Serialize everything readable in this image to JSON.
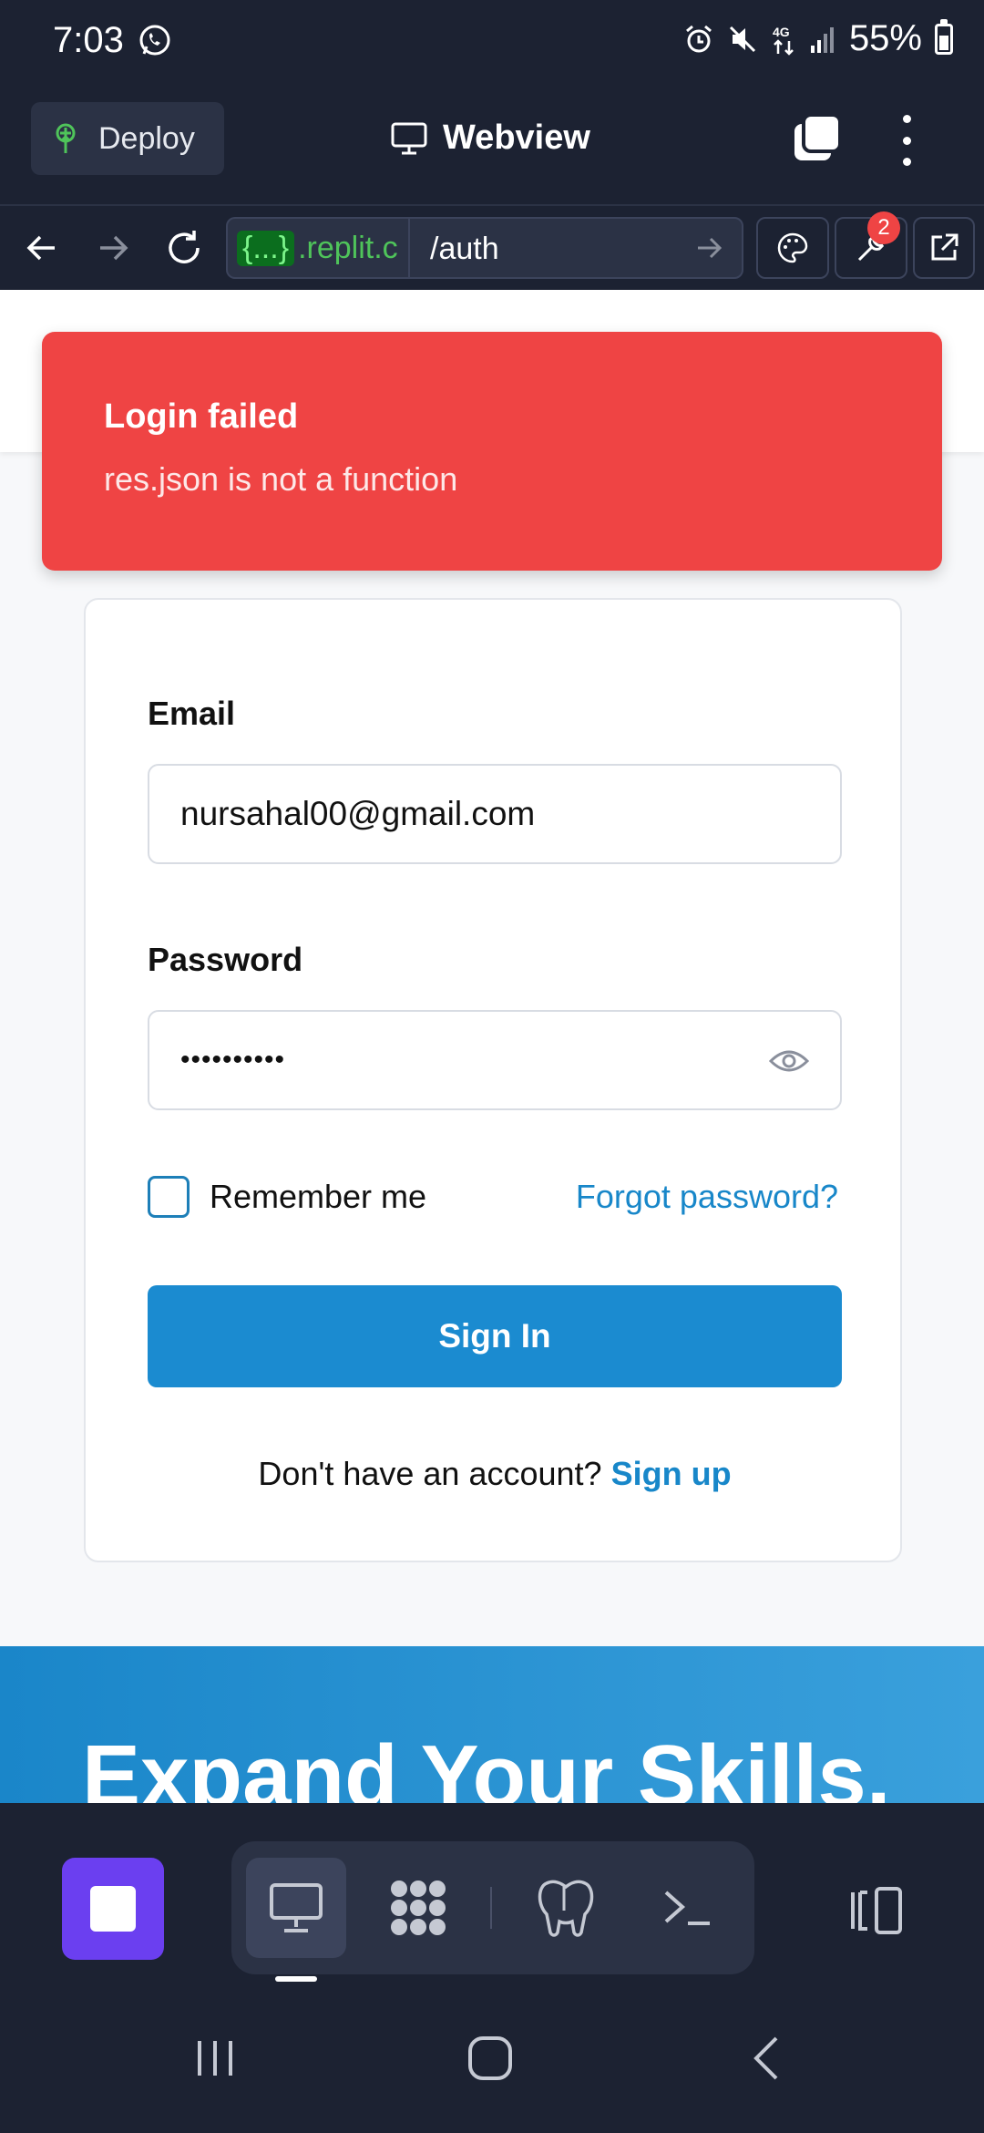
{
  "status_bar": {
    "time": "7:03",
    "battery": "55%",
    "network": "4G"
  },
  "header": {
    "deploy_label": "Deploy",
    "title": "Webview"
  },
  "nav": {
    "url_host": ".replit.c",
    "url_host_tag": "{...}",
    "url_path": "/auth",
    "devtools_badge": "2"
  },
  "toast": {
    "title": "Login failed",
    "message": "res.json is not a function"
  },
  "login_form": {
    "email_label": "Email",
    "email_value": "nursahal00@gmail.com",
    "password_label": "Password",
    "password_value": "••••••••••",
    "remember_label": "Remember me",
    "forgot_link": "Forgot password?",
    "submit_label": "Sign In",
    "signup_prompt": "Don't have an account?",
    "signup_link": "Sign up"
  },
  "hero": {
    "heading": "Expand Your Skills,"
  },
  "colors": {
    "app_bg": "#1c2232",
    "toast_bg": "#ef4444",
    "primary": "#1b8bd0",
    "link": "#1887c9",
    "stop_button": "#6b3ff0"
  },
  "icons": [
    "whatsapp-icon",
    "alarm-icon",
    "mute-icon",
    "network-icon",
    "signal-icon",
    "battery-icon",
    "deploy-icon",
    "monitor-icon",
    "tabs-icon",
    "more-icon",
    "back-arrow-icon",
    "forward-arrow-icon",
    "reload-icon",
    "go-arrow-icon",
    "palette-icon",
    "wrench-icon",
    "external-link-icon",
    "eye-icon",
    "stop-icon",
    "webview-tool-icon",
    "workflows-icon",
    "postgres-icon",
    "shell-icon",
    "layout-icon",
    "recents-icon",
    "home-icon",
    "back-icon"
  ]
}
